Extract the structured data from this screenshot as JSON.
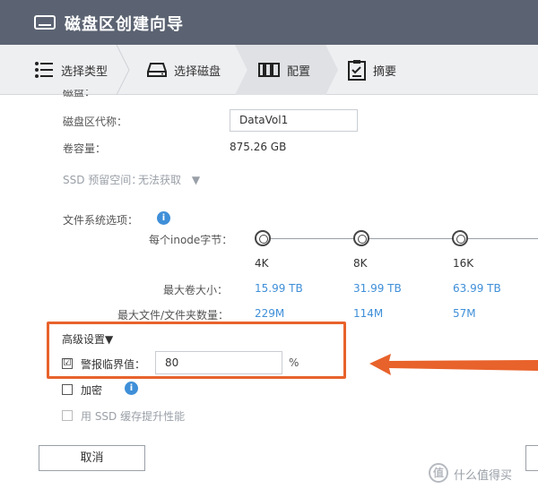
{
  "window": {
    "title": "磁盘区创建向导"
  },
  "steps": [
    {
      "label": "选择类型",
      "icon": "list-icon"
    },
    {
      "label": "选择磁盘",
      "icon": "disk-icon"
    },
    {
      "label": "配置",
      "icon": "config-icon",
      "active": true
    },
    {
      "label": "摘要",
      "icon": "clipboard-icon"
    }
  ],
  "form": {
    "cut_heading": "磁盘：",
    "alias_label": "磁盘区代称：",
    "alias_value": "DataVol1",
    "capacity_label": "卷容量：",
    "capacity_value": "875.26 GB",
    "ssd_label": "SSD 预留空间：",
    "ssd_value": "无法获取",
    "ssd_caret": "▼",
    "fs_label": "文件系统选项：",
    "inode_label": "每个inode字节：",
    "max_vol_label": "最大卷大小：",
    "max_files_label": "最大文件/文件夹数量：",
    "inode_options": [
      {
        "size": "4K",
        "max_vol": "15.99 TB",
        "max_files": "229M"
      },
      {
        "size": "8K",
        "max_vol": "31.99 TB",
        "max_files": "114M"
      },
      {
        "size": "16K",
        "max_vol": "63.99 TB",
        "max_files": "57M"
      }
    ],
    "advanced_label": "高级设置▼",
    "alert_label": "警报临界值：",
    "alert_checked": "☑",
    "alert_value": "80",
    "alert_unit": "%",
    "encrypt_label": "加密",
    "ssd_cache_label": "用 SSD 缓存提升性能"
  },
  "buttons": {
    "cancel": "取消"
  },
  "watermark": {
    "text": "什么值得买",
    "logo": "值"
  },
  "colors": {
    "titlebar": "#5b6372",
    "accent": "#3f8fd8",
    "highlight": "#e8622b"
  }
}
